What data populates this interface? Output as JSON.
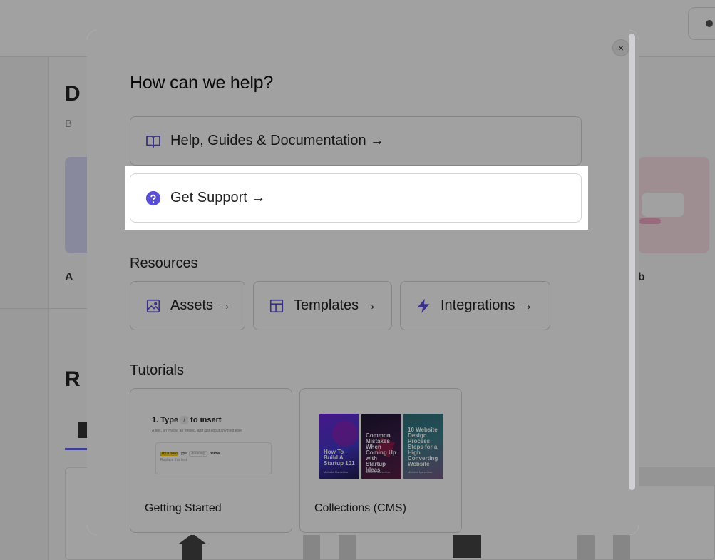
{
  "modal": {
    "title": "How can we help?",
    "close_glyph": "×",
    "links": {
      "help_docs": "Help, Guides & Documentation →",
      "get_support": "Get Support →"
    },
    "resources": {
      "title": "Resources",
      "items": [
        "Assets →",
        "Templates →",
        "Integrations →"
      ]
    },
    "tutorials": {
      "title": "Tutorials",
      "getting_started": {
        "label": "Getting Started",
        "thumb_heading_pre": "1. Type",
        "thumb_slash": "/",
        "thumb_heading_post": "to insert",
        "thumb_line": "A text, an image, an embed, and just about anything else!",
        "thumb_highlight": "Try it now!",
        "thumb_type": "Type",
        "thumb_chip": "/heading",
        "thumb_below": "below",
        "thumb_sub": "Replace this text"
      },
      "collections": {
        "label": "Collections (CMS)",
        "books": [
          {
            "title": "How To Build A Startup 101",
            "author": "Michelle Marcellino"
          },
          {
            "title": "Common Mistakes When Coming Up with Startup Ideas",
            "author": "Michelle Marcellino"
          },
          {
            "title": "10 Website Design Process Steps for a High Converting Website",
            "author": "Michelle Marcellino"
          }
        ]
      }
    }
  },
  "colors": {
    "accent": "#5b4fd6",
    "border": "#d4d4d8",
    "overlay": "rgba(0,0,0,0.37)"
  },
  "icons": {
    "help_docs": "book-open-icon",
    "get_support": "question-circle-icon",
    "assets": "image-icon",
    "templates": "layout-icon",
    "integrations": "lightning-bolt-icon",
    "close": "close-icon"
  }
}
